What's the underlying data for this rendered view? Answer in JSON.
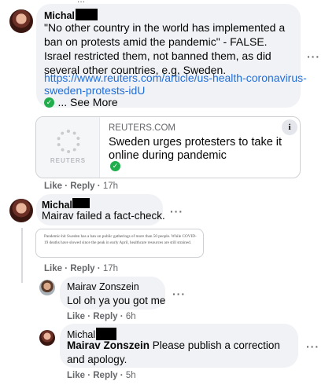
{
  "top_fragment": "...",
  "comments": [
    {
      "author": "Michal",
      "text": "\"No other country in the world has implemented a ban on protests amid the pandemic\" - FALSE. Israel restricted them, not banned them, as did several other countries, e.g. Sweden.",
      "link_lines": [
        "https://www.reuters.com/article/us-health-coronavirus-",
        "sweden-protests-idU"
      ],
      "see_more": "... See More",
      "preview": {
        "logo": "REUTERS",
        "domain": "REUTERS.COM",
        "title": "Sweden urges protesters to take it online during pandemic"
      },
      "actions": {
        "like": "Like",
        "reply": "Reply",
        "time": "17h"
      }
    },
    {
      "author": "Michal",
      "text": "Mairav failed a fact-check.",
      "attachment_text": "Pandemic-hit Sweden has a ban on public gatherings of more than 50 people. While COVID-19 deaths have slowed since the peak in early April, healthcare resources are still strained.",
      "actions": {
        "like": "Like",
        "reply": "Reply",
        "time": "17h"
      }
    },
    {
      "author": "Mairav Zonszein",
      "text": "Lol oh ya you got me",
      "actions": {
        "like": "Like",
        "reply": "Reply",
        "time": "6h"
      }
    },
    {
      "author": "Michal",
      "mention": "Mairav Zonszein",
      "text": " Please publish a correction and apology.",
      "actions": {
        "like": "Like",
        "reply": "Reply",
        "time": "5h"
      }
    }
  ],
  "icons": {
    "more": "more-options-icon",
    "info": "info-icon",
    "verified": "check-icon"
  },
  "colors": {
    "bubble": "#f0f2f5",
    "link": "#216fdb",
    "meta": "#65676b",
    "check": "#1fae4b"
  }
}
